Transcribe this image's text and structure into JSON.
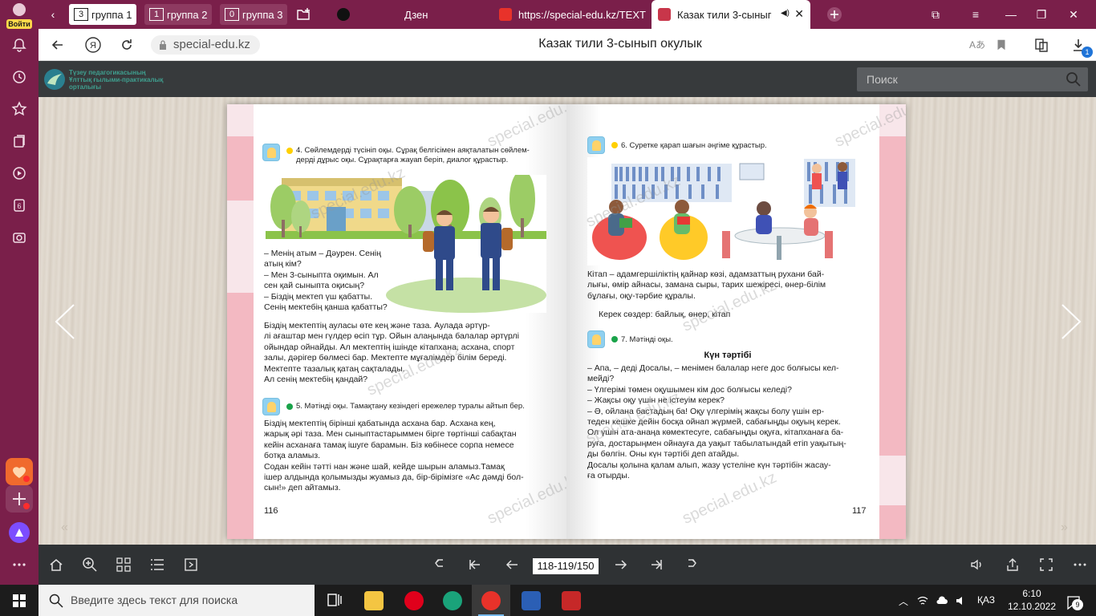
{
  "sidebar": {
    "login_label": "Войти",
    "badge_6": "6"
  },
  "tabs": {
    "groups": [
      {
        "num": "3",
        "label": "группа 1"
      },
      {
        "num": "1",
        "label": "группа 2"
      },
      {
        "num": "0",
        "label": "группа 3"
      }
    ],
    "items": [
      {
        "label": "Дзен",
        "icon": "zen-icon"
      },
      {
        "label": "https://special-edu.kz/TEXT",
        "icon": "yandex-icon"
      },
      {
        "label": "Казак тили 3-сыныг",
        "icon": "site-icon"
      }
    ]
  },
  "address": {
    "url": "special-edu.kz",
    "page_title": "Казак тили 3-сынып окулык",
    "download_count": "1"
  },
  "site": {
    "logo_line1": "Түзеу педагогикасының",
    "logo_line2": "Ұлттық ғылыми-практикалық",
    "logo_line3": "орталығы",
    "search_placeholder": "Поиск"
  },
  "book": {
    "left": {
      "task4": "4. Сөйлемдерді түсініп оқы. Сұрақ белгісімен аяқталатын сөйлем-\nдерді дұрыс оқы. Сұрақтарға жауап беріп, диалог құрастыр.",
      "dialog": "– Менің атым – Дәурен. Сенің\nатың кім?\n– Мен 3-сыныпта оқимын. Ал\nсен қай сыныпта оқисың?\n– Біздің мектеп үш қабатты.\nСенің мектебің қанша қабатты?",
      "para1": "Біздің мектептің ауласы өте кең және таза. Аулада әртүр-\nлі ағаштар мен гүлдер өсіп тұр. Ойын алаңында балалар әртүрлі\nойындар ойнайды. Ал мектептің ішінде кітапхана, асхана, спорт\nзалы, дәрігер бөлмесі бар. Мектепте мұғалімдер білім береді.\nМектепте тазалық қатаң сақталады.\nАл сенің мектебің қандай?",
      "task5": "5. Мәтінді оқы. Тамақтану кезіндегі ережелер туралы айтып бер.",
      "para2": "Біздің мектептің бірінші қабатында асхана бар. Асхана кең,\nжарық әрі таза. Мен сыныптастарыммен бірге төртінші сабақтан\nкейін асханаға тамақ ішуге барамын. Біз көбінесе сорпа немесе\nботқа аламыз.\nСодан кейін тәтті нан және шай, кейде шырын аламыз.Тамақ\nішер алдында қолымызды жуамыз да, бір-бірімізге «Ас дәмді бол-\nсын!» деп айтамыз.",
      "page_number": "116"
    },
    "right": {
      "task6": "6. Суретке қарап шағын әңгіме құрастыр.",
      "para1": "Кітап – адамгершіліктің қайнар көзі, адамзаттың рухани бай-\nлығы, өмір айнасы, замана сыры, тарих шежіресі, өнер-білім\nбұлағы, оқу-тәрбие құралы.",
      "words": "Керек сөздер: байлық, өнер, кітап",
      "task7": "7. Мәтінді оқы.",
      "story_title": "Күн тәртібі",
      "story": "– Апа, – деді Досалы, – менімен балалар неге дос болғысы кел-\nмейді?\n– Үлгерімі төмен оқушымен кім дос болғысы келеді?\n– Жақсы оқу үшін не істеуім керек?\n– Ә, ойлана бастадың ба! Оқу үлгерімің жақсы болу үшін ер-\nтеден кешке дейін босқа ойнап жүрмей, сабағыңды оқуың керек.\nОл үшін ата-анаңа көмектесуге, сабағыңды оқуға, кітапханаға ба-\nруға, достарыңмен ойнауға да уақыт табылатындай етіп уақытың-\nды бөлгін. Оны күн тәртібі деп атайды.\nДосалы қолына қалам алып, жазу үстеліне күн тәртібін жасау-\nға отырды.",
      "page_number": "117"
    },
    "watermark": "special.edu.kz"
  },
  "reader": {
    "page_indicator": "118-119/150"
  },
  "taskbar": {
    "search_placeholder": "Введите здесь текст для поиска",
    "language": "ҚАЗ",
    "time": "6:10",
    "date": "12.10.2022",
    "notifications": "9"
  },
  "colors": {
    "browser_accent": "#7a1f4a",
    "pink_strip": "#f3b9c2",
    "yellow_bullet": "#ffd000",
    "green_bullet": "#1aa34a"
  }
}
